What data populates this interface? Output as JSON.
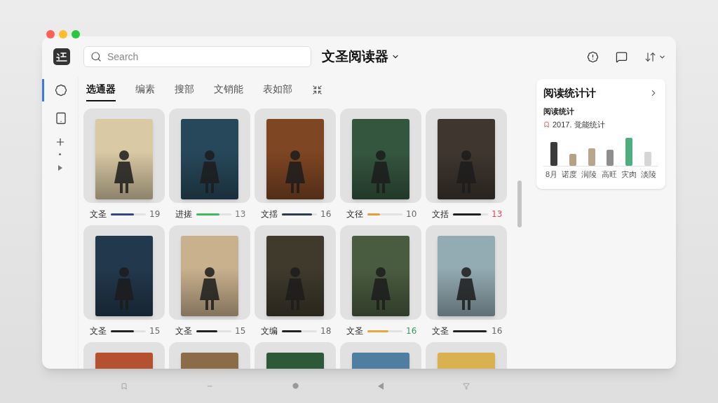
{
  "window": {
    "title": "文圣阅读器"
  },
  "search": {
    "placeholder": "Search"
  },
  "sidebar": {
    "items": [
      {
        "selected": true
      },
      {
        "selected": false
      }
    ]
  },
  "tabs": [
    {
      "label": "选通器",
      "selected": true
    },
    {
      "label": "编素",
      "selected": false
    },
    {
      "label": "搜部",
      "selected": false
    },
    {
      "label": "文销能",
      "selected": false
    },
    {
      "label": "表如部",
      "selected": false
    }
  ],
  "books": [
    {
      "title": "文圣",
      "cover": {
        "color": "#d9c9a4"
      },
      "progress": {
        "level": 0.65,
        "color": "#2e4a86"
      },
      "count": {
        "text": "19",
        "color": "#666666"
      }
    },
    {
      "title": "进搓",
      "cover": {
        "color": "#27485a"
      },
      "progress": {
        "level": 0.65,
        "color": "#3dbb5a"
      },
      "count": {
        "text": "13",
        "color": "#777777"
      }
    },
    {
      "title": "文揺",
      "cover": {
        "color": "#7e4623"
      },
      "progress": {
        "level": 0.85,
        "color": "#2b3a55"
      },
      "count": {
        "text": "16",
        "color": "#666666"
      }
    },
    {
      "title": "文径",
      "cover": {
        "color": "#34563f"
      },
      "progress": {
        "level": 0.35,
        "color": "#e79a35"
      },
      "count": {
        "text": "10",
        "color": "#666666"
      }
    },
    {
      "title": "文括",
      "cover": {
        "color": "#3e362f"
      },
      "progress": {
        "level": 0.8,
        "color": "#1f1f1f"
      },
      "count": {
        "text": "13",
        "color": "#e0475b"
      }
    },
    {
      "title": "文圣",
      "cover": {
        "color": "#22384c"
      },
      "progress": {
        "level": 0.65,
        "color": "#222222"
      },
      "count": {
        "text": "15",
        "color": "#666666"
      }
    },
    {
      "title": "文圣",
      "cover": {
        "color": "#c9b18e"
      },
      "progress": {
        "level": 0.6,
        "color": "#222222"
      },
      "count": {
        "text": "15",
        "color": "#666666"
      }
    },
    {
      "title": "文编",
      "cover": {
        "color": "#3f3a2c"
      },
      "progress": {
        "level": 0.55,
        "color": "#222222"
      },
      "count": {
        "text": "18",
        "color": "#666666"
      }
    },
    {
      "title": "文圣",
      "cover": {
        "color": "#4a5c40"
      },
      "progress": {
        "level": 0.6,
        "color": "#e8a640"
      },
      "count": {
        "text": "16",
        "color": "#3c9a5e"
      }
    },
    {
      "title": "文圣",
      "cover": {
        "color": "#93abb3"
      },
      "progress": {
        "level": 0.96,
        "color": "#222222"
      },
      "count": {
        "text": "16",
        "color": "#666666"
      }
    },
    {
      "cover": {
        "color": "#b4512e"
      }
    },
    {
      "cover": {
        "color": "#8c6b48"
      }
    },
    {
      "cover": {
        "color": "#2c5a38"
      }
    },
    {
      "cover": {
        "color": "#4f7fa0"
      }
    },
    {
      "cover": {
        "color": "#d9b150"
      }
    }
  ],
  "stats_panel": {
    "title": "阅读统计计",
    "subtitle": "阅读统计",
    "note": "2017. 觉能统计",
    "bars": [
      {
        "label": "8月",
        "color": "#3a3a3a"
      },
      {
        "label": "诺度",
        "color": "#b5a186"
      },
      {
        "label": "润陵",
        "color": "#b9a68c"
      },
      {
        "label": "高旺",
        "color": "#8e8e8e"
      },
      {
        "label": "灾肉",
        "color": "#4fae7e"
      },
      {
        "label": "淡陵",
        "color": "#d6d6d6"
      }
    ]
  }
}
